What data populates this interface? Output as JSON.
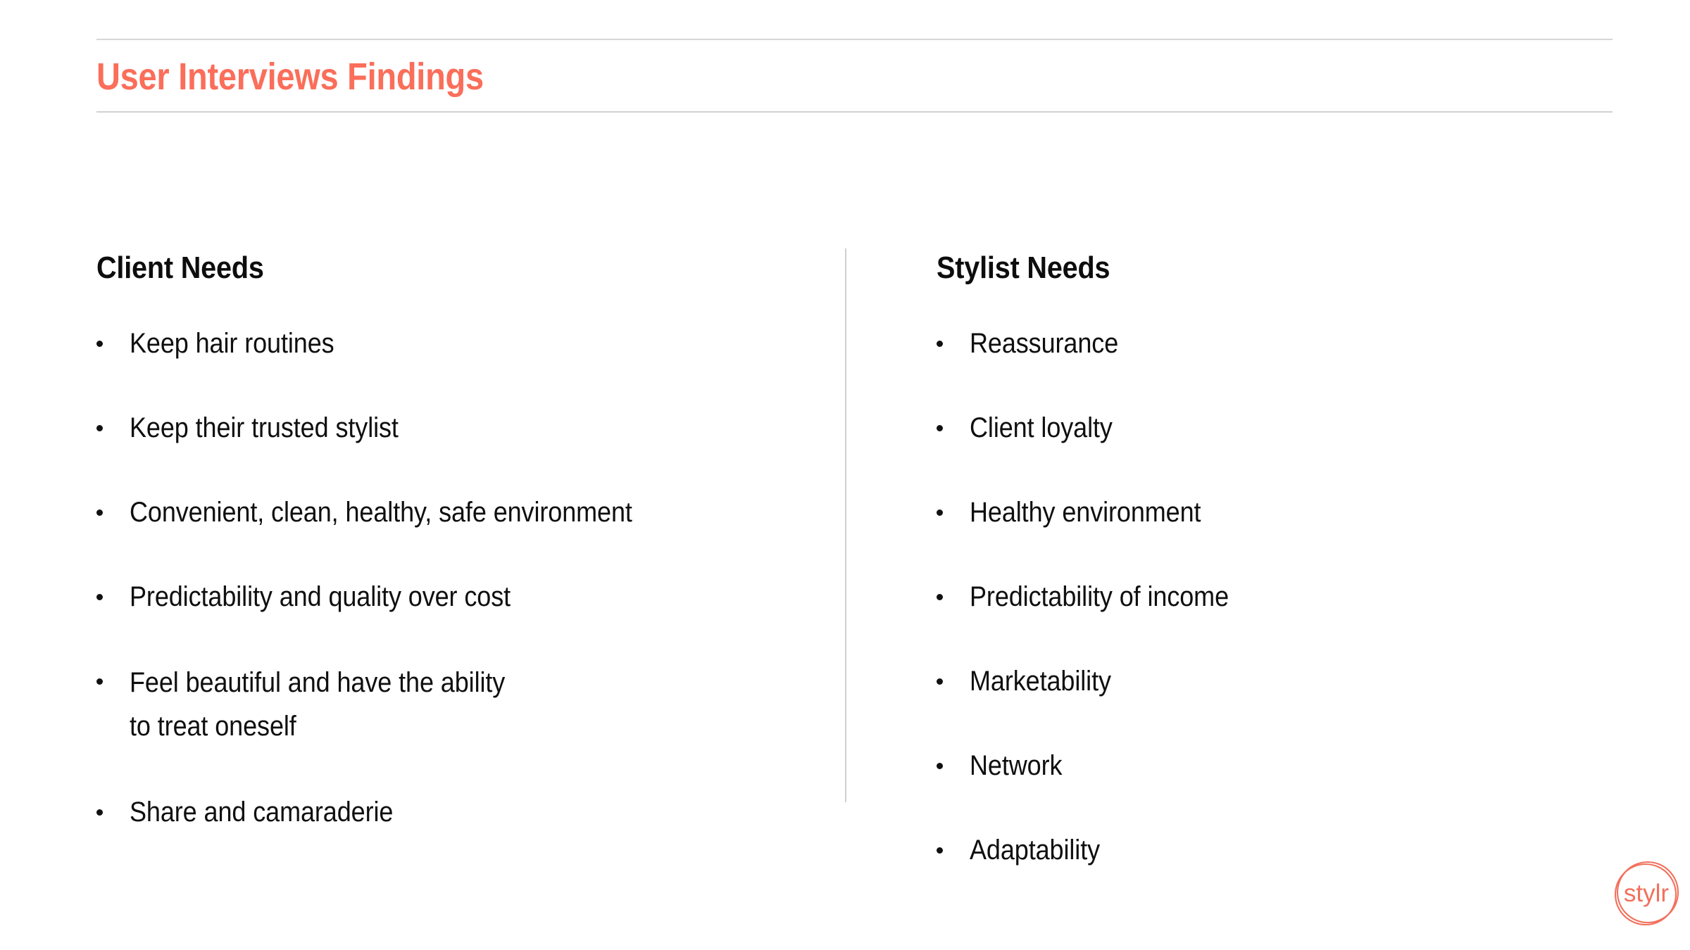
{
  "header": {
    "title": "User Interviews Findings",
    "accent_color": "#FA6E5A",
    "rule_color": "#D4D4D4"
  },
  "columns": [
    {
      "heading": "Client Needs",
      "bullets": [
        "Keep hair routines",
        "Keep their trusted stylist",
        "Convenient, clean, healthy, safe environment",
        "Predictability and quality over cost",
        "Feel beautiful and have the ability\nto treat oneself",
        "Share and camaraderie"
      ]
    },
    {
      "heading": "Stylist Needs",
      "bullets": [
        "Reassurance",
        "Client loyalty",
        "Healthy environment",
        "Predictability of income",
        "Marketability",
        "Network",
        "Adaptability"
      ]
    }
  ],
  "logo": {
    "wordmark": "stylr",
    "color": "#F2705C"
  },
  "theme": {
    "background": "#FFFFFF",
    "text_color": "#0F0F0F",
    "divider_color": "#CFCFCF"
  }
}
